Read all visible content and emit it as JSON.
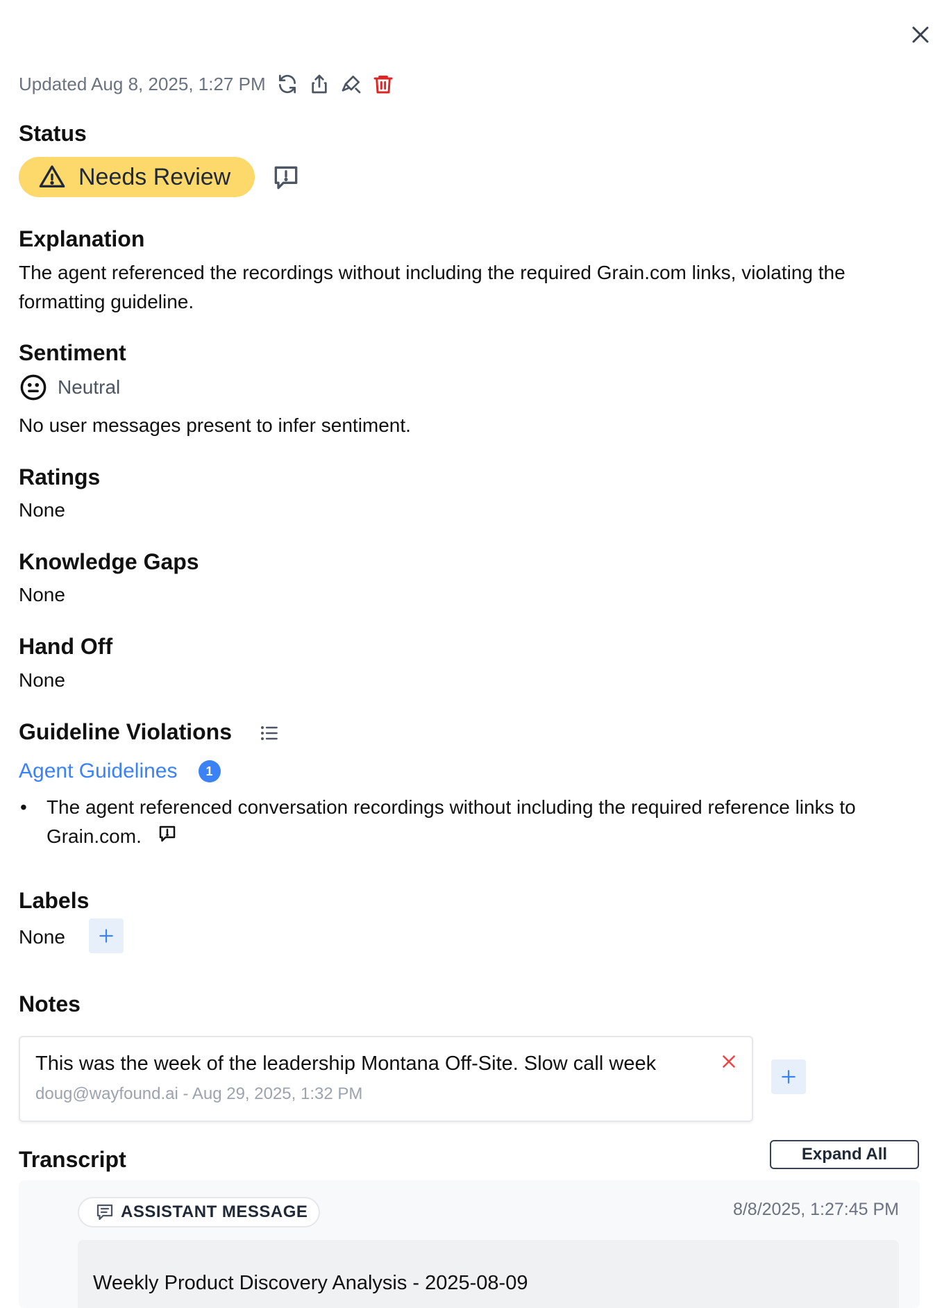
{
  "header": {
    "updated": "Updated Aug 8, 2025, 1:27 PM"
  },
  "status": {
    "title": "Status",
    "value": "Needs Review",
    "color": "#fcd96a"
  },
  "explanation": {
    "title": "Explanation",
    "text": "The agent referenced the recordings without including the required Grain.com links, violating the formatting guideline."
  },
  "sentiment": {
    "title": "Sentiment",
    "value": "Neutral",
    "text": "No user messages present to infer sentiment."
  },
  "ratings": {
    "title": "Ratings",
    "value": "None"
  },
  "knowledge_gaps": {
    "title": "Knowledge Gaps",
    "value": "None"
  },
  "hand_off": {
    "title": "Hand Off",
    "value": "None"
  },
  "guideline_violations": {
    "title": "Guideline Violations",
    "group_label": "Agent Guidelines",
    "count": "1",
    "items": [
      "The agent referenced conversation recordings without including the required reference links to Grain.com."
    ]
  },
  "labels": {
    "title": "Labels",
    "value": "None"
  },
  "notes": {
    "title": "Notes",
    "items": [
      {
        "text": "This was the week of the leadership Montana Off-Site. Slow call week",
        "meta": "doug@wayfound.ai - Aug 29, 2025, 1:32 PM"
      }
    ]
  },
  "transcript": {
    "title": "Transcript",
    "expand_label": "Expand All",
    "messages": [
      {
        "type_label": "ASSISTANT MESSAGE",
        "time": "8/8/2025, 1:27:45 PM",
        "text": "Weekly Product Discovery Analysis - 2025-08-09"
      }
    ]
  },
  "colors": {
    "accent": "#3b82f6",
    "danger": "#dc2626",
    "muted": "#6b7280"
  }
}
